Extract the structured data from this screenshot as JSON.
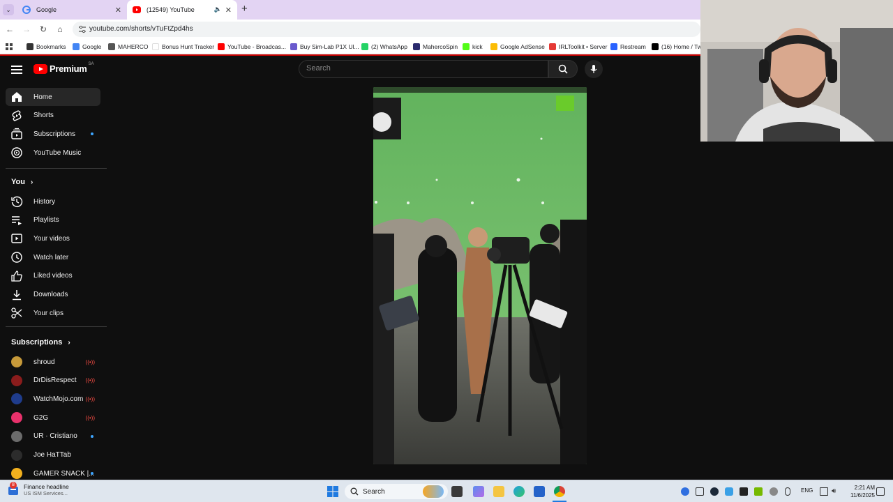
{
  "browser": {
    "tabs": [
      {
        "title": "Google"
      },
      {
        "title": "(12549) YouTube"
      }
    ],
    "url": "youtube.com/shorts/vTuFtZpd4hs",
    "bookmarks": [
      {
        "label": "Bookmarks",
        "color": "#333333"
      },
      {
        "label": "Google",
        "color": "#4285f4"
      },
      {
        "label": "MAHERCO",
        "color": "#555555"
      },
      {
        "label": "Bonus Hunt Tracker",
        "color": "#ffffff"
      },
      {
        "label": "YouTube - Broadcas...",
        "color": "#ff0000"
      },
      {
        "label": "Buy Sim-Lab P1X Ul...",
        "color": "#6a5acd"
      },
      {
        "label": "(2) WhatsApp",
        "color": "#25d366"
      },
      {
        "label": "MahercoSpin",
        "color": "#2b2b6e"
      },
      {
        "label": "kick",
        "color": "#53fc18"
      },
      {
        "label": "Google AdSense",
        "color": "#fbbc04"
      },
      {
        "label": "IRLToolkit • Server",
        "color": "#e53935"
      },
      {
        "label": "Restream",
        "color": "#2962ff"
      },
      {
        "label": "(16) Home / Tw",
        "color": "#000000"
      }
    ]
  },
  "youtube": {
    "logo_text": "Premium",
    "country": "SA",
    "search_placeholder": "Search",
    "nav_main": [
      {
        "label": "Home",
        "icon": "home-icon",
        "active": true
      },
      {
        "label": "Shorts",
        "icon": "shorts-icon"
      },
      {
        "label": "Subscriptions",
        "icon": "subscriptions-icon",
        "dot": true
      },
      {
        "label": "YouTube Music",
        "icon": "music-icon"
      }
    ],
    "you_title": "You",
    "nav_you": [
      {
        "label": "History",
        "icon": "history-icon"
      },
      {
        "label": "Playlists",
        "icon": "playlists-icon"
      },
      {
        "label": "Your videos",
        "icon": "your-videos-icon"
      },
      {
        "label": "Watch later",
        "icon": "watch-later-icon"
      },
      {
        "label": "Liked videos",
        "icon": "like-icon"
      },
      {
        "label": "Downloads",
        "icon": "download-icon"
      },
      {
        "label": "Your clips",
        "icon": "scissors-icon"
      }
    ],
    "subs_title": "Subscriptions",
    "subscriptions": [
      {
        "name": "shroud",
        "status": "live",
        "color": "#c79a3a"
      },
      {
        "name": "DrDisRespect",
        "status": "live",
        "color": "#8a1c1c"
      },
      {
        "name": "WatchMojo.com",
        "status": "live",
        "color": "#1f3c8c"
      },
      {
        "name": "G2G",
        "status": "live",
        "color": "#e8316b"
      },
      {
        "name": "UR · Cristiano",
        "status": "dot",
        "color": "#6b6b6b"
      },
      {
        "name": "Joe HaTTab",
        "status": "none",
        "color": "#2c2c2c"
      },
      {
        "name": "GAMER SNACK |...",
        "status": "dot",
        "color": "#f2b01e"
      }
    ],
    "live_glyph": "((•))"
  },
  "taskbar": {
    "weather_badge": "8",
    "headline": "Finance headline",
    "subheadline": "US ISM Services...",
    "search_label": "Search",
    "language": "ENG",
    "time": "2:21 AM",
    "date": "11/6/2025"
  }
}
